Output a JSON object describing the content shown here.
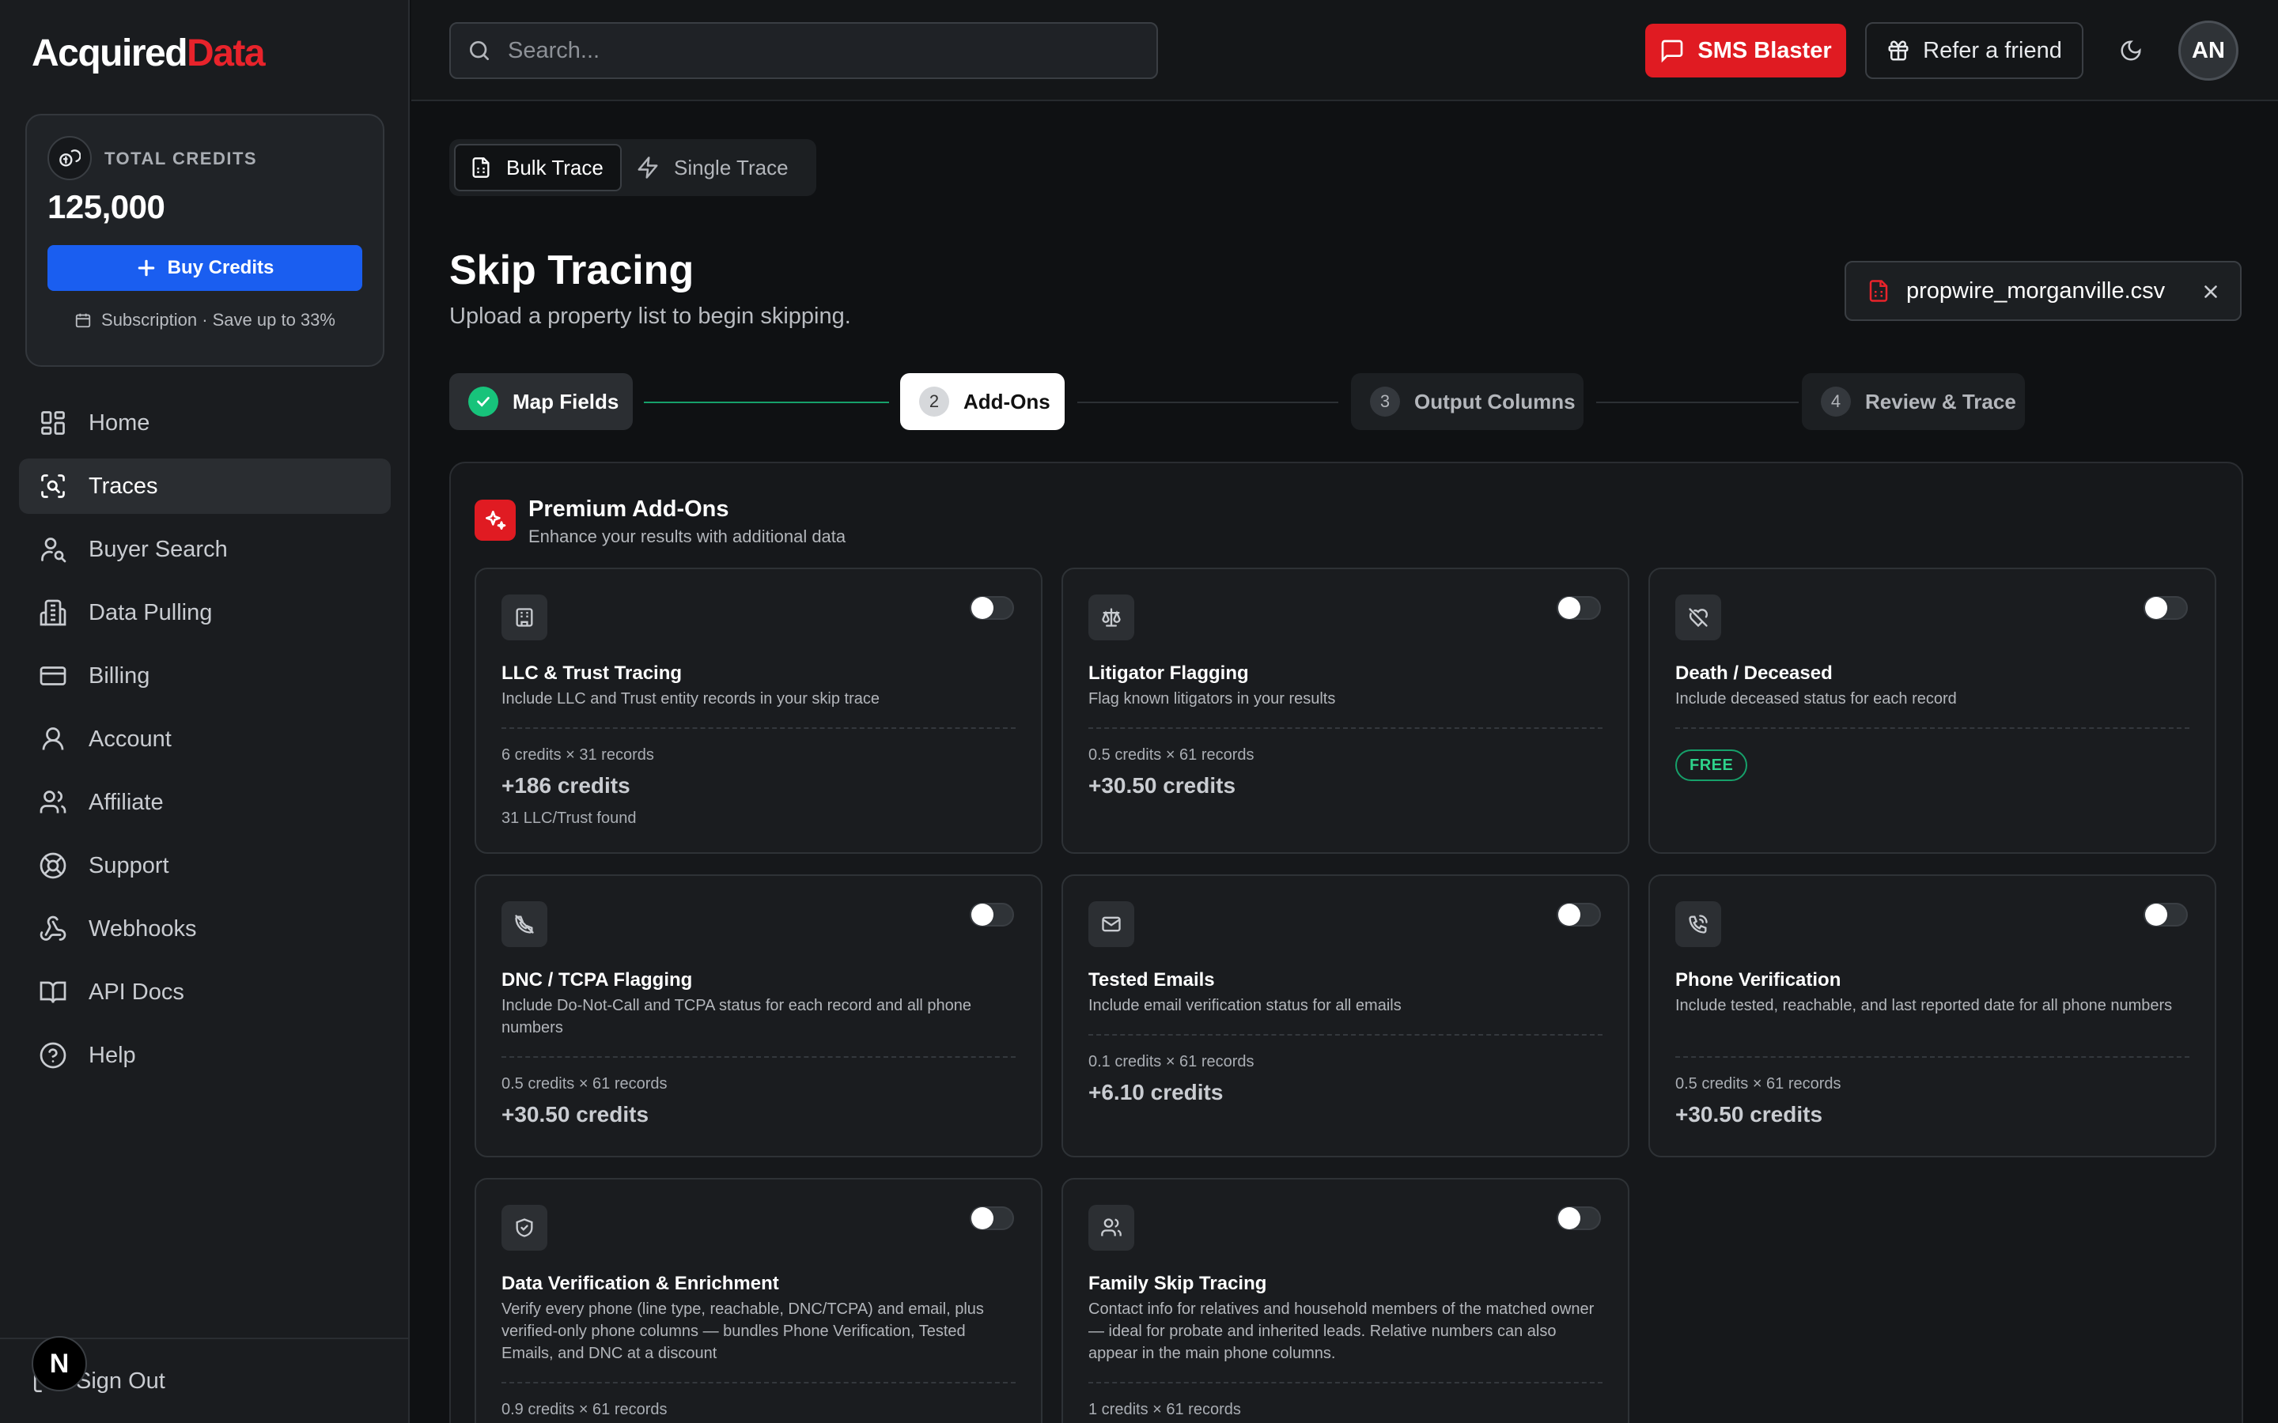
{
  "brand": {
    "name": "Acquired",
    "accent": "Data"
  },
  "credits": {
    "label": "TOTAL CREDITS",
    "amount": "125,000",
    "buy_label": "Buy Credits",
    "subscription": "Subscription · Save up to 33%"
  },
  "nav": {
    "items": [
      {
        "label": "Home",
        "icon": "home-icon"
      },
      {
        "label": "Traces",
        "icon": "traces-icon",
        "active": true
      },
      {
        "label": "Buyer Search",
        "icon": "buyer-search-icon"
      },
      {
        "label": "Data Pulling",
        "icon": "data-pulling-icon"
      },
      {
        "label": "Billing",
        "icon": "billing-icon"
      },
      {
        "label": "Account",
        "icon": "account-icon"
      },
      {
        "label": "Affiliate",
        "icon": "affiliate-icon"
      },
      {
        "label": "Support",
        "icon": "support-icon"
      },
      {
        "label": "Webhooks",
        "icon": "webhooks-icon"
      },
      {
        "label": "API Docs",
        "icon": "api-docs-icon"
      },
      {
        "label": "Help",
        "icon": "help-icon"
      }
    ],
    "signout": "Sign Out",
    "badge": "N"
  },
  "header": {
    "search_placeholder": "Search...",
    "sms_label": "SMS Blaster",
    "refer_label": "Refer a friend",
    "avatar_initials": "AN"
  },
  "main": {
    "tabs": [
      {
        "label": "Bulk Trace",
        "active": true
      },
      {
        "label": "Single Trace"
      }
    ],
    "title": "Skip Tracing",
    "subtitle": "Upload a property list to begin skipping.",
    "file_name": "propwire_morganville.csv",
    "steps": [
      {
        "num": "1",
        "label": "Map Fields",
        "state": "done"
      },
      {
        "num": "2",
        "label": "Add-Ons",
        "state": "current"
      },
      {
        "num": "3",
        "label": "Output Columns",
        "state": "pending"
      },
      {
        "num": "4",
        "label": "Review & Trace",
        "state": "pending"
      }
    ]
  },
  "addons": {
    "title": "Premium Add-Ons",
    "subtitle": "Enhance your results with additional data",
    "cards": [
      {
        "title": "LLC & Trust Tracing",
        "desc": "Include LLC and Trust entity records in your skip trace",
        "calc": "6 credits × 31 records",
        "total": "+186 credits",
        "extra": "31 LLC/Trust found",
        "icon": "building-icon",
        "enabled": false
      },
      {
        "title": "Litigator Flagging",
        "desc": "Flag known litigators in your results",
        "calc": "0.5 credits × 61 records",
        "total": "+30.50 credits",
        "icon": "scale-icon",
        "enabled": false
      },
      {
        "title": "Death / Deceased",
        "desc": "Include deceased status for each record",
        "badge": "FREE",
        "icon": "heart-off-icon",
        "enabled": false
      },
      {
        "title": "DNC / TCPA Flagging",
        "desc": "Include Do-Not-Call and TCPA status for each record and all phone numbers",
        "calc": "0.5 credits × 61 records",
        "total": "+30.50 credits",
        "icon": "phone-off-icon",
        "enabled": false
      },
      {
        "title": "Tested Emails",
        "desc": "Include email verification status for all emails",
        "calc": "0.1 credits × 61 records",
        "total": "+6.10 credits",
        "icon": "mail-icon",
        "enabled": false
      },
      {
        "title": "Phone Verification",
        "desc": "Include tested, reachable, and last reported date for all phone numbers",
        "calc": "0.5 credits × 61 records",
        "total": "+30.50 credits",
        "icon": "phone-call-icon",
        "enabled": false
      },
      {
        "title": "Data Verification & Enrichment",
        "desc": "Verify every phone (line type, reachable, DNC/TCPA) and email, plus verified-only phone columns — bundles Phone Verification, Tested Emails, and DNC at a discount",
        "calc": "0.9 credits × 61 records",
        "icon": "shield-check-icon",
        "enabled": false
      },
      {
        "title": "Family Skip Tracing",
        "desc": "Contact info for relatives and household members of the matched owner — ideal for probate and inherited leads. Relative numbers can also appear in the main phone columns.",
        "calc": "1 credits × 61 records",
        "icon": "users-icon",
        "enabled": false
      }
    ]
  },
  "colors": {
    "brand_red": "#e8232b",
    "primary_blue": "#1a5ef0",
    "success_green": "#17c37b",
    "background": "#0f1113"
  }
}
